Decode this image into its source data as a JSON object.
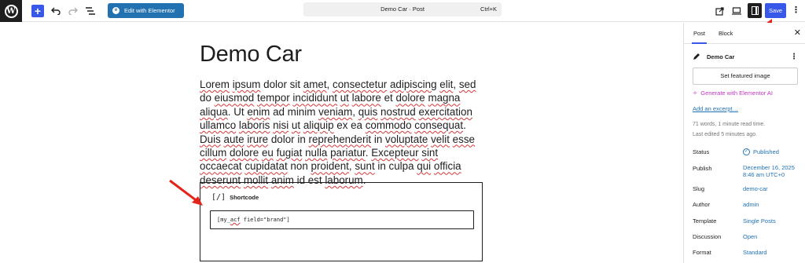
{
  "topbar": {
    "add_label": "+",
    "elementor_label": "Edit with Elementor",
    "command_title": "Demo Car · Post",
    "command_shortcut": "Ctrl+K",
    "save_label": "Save"
  },
  "editor": {
    "title": "Demo Car",
    "shortcode_block_label": "Shortcode",
    "shortcode_icon": "[/]",
    "shortcode_value": "[my_acf field=\"brand\"]"
  },
  "sidebar": {
    "tab_post": "Post",
    "tab_block": "Block",
    "doc_title": "Demo Car",
    "featured_image_button": "Set featured image",
    "generate_elementor": "Generate with Elementor AI",
    "add_excerpt": "Add an excerpt…",
    "words_info": "71 words, 1 minute read time.",
    "last_edited": "Last edited 5 minutes ago.",
    "rows": {
      "status_label": "Status",
      "status_value": "Published",
      "publish_label": "Publish",
      "publish_value_1": "December 16, 2025",
      "publish_value_2": "8:46 am UTC+0",
      "slug_label": "Slug",
      "slug_value": "demo-car",
      "author_label": "Author",
      "author_value": "admin",
      "template_label": "Template",
      "template_value": "Single Posts",
      "discussion_label": "Discussion",
      "discussion_value": "Open",
      "format_label": "Format",
      "format_value": "Standard"
    }
  },
  "colors": {
    "accent": "#3858e9",
    "link": "#2271b1",
    "elementor": "#2271b1",
    "arrow": "#e3241b"
  },
  "icons": [
    "wordpress-logo-icon",
    "plus-icon",
    "undo-icon",
    "redo-icon",
    "list-view-icon",
    "elementor-icon",
    "external-link-icon",
    "desktop-icon",
    "sidebar-toggle-icon",
    "more-vertical-icon",
    "close-icon",
    "post-icon",
    "sparkle-icon",
    "check-circle-icon",
    "shortcode-icon",
    "red-arrow-icon"
  ]
}
